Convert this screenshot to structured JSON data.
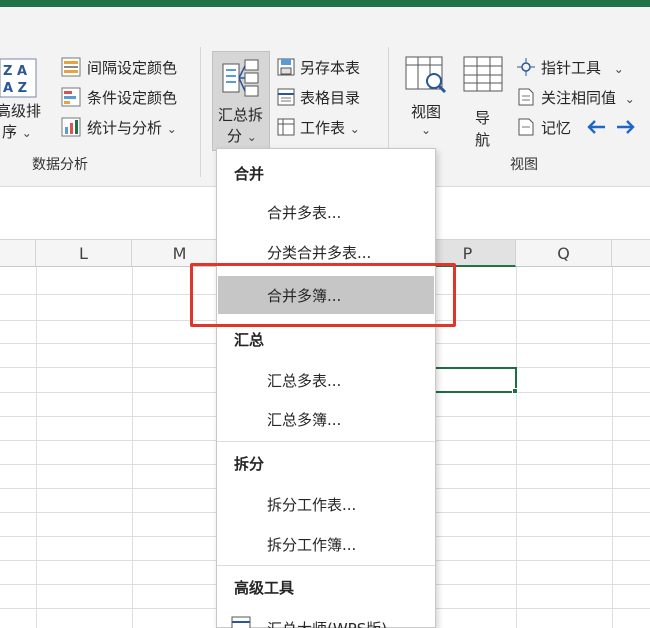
{
  "ribbon": {
    "sort_large": {
      "line1": "高级排",
      "line2": "序"
    },
    "data_group": {
      "interval_color": "间隔设定颜色",
      "condition_color": "条件设定颜色",
      "stats_analysis": "统计与分析",
      "group_label": "数据分析"
    },
    "summary_split": {
      "line1": "汇总拆",
      "line2": "分"
    },
    "sheet_group": {
      "save_as": "另存本表",
      "toc": "表格目录",
      "worksheet": "工作表"
    },
    "view_group": {
      "view": "视图",
      "nav_line1": "导",
      "nav_line2": "航",
      "pointer_tool": "指针工具",
      "focus_same": "关注相同值",
      "memo": "记忆",
      "group_label": "视图"
    }
  },
  "grid": {
    "columns": [
      "L",
      "M",
      "P",
      "Q"
    ]
  },
  "menu": {
    "merge_header": "合并",
    "merge_sheets": "合并多表...",
    "classify_merge": "分类合并多表...",
    "merge_books": "合并多簿...",
    "summary_header": "汇总",
    "summary_sheets": "汇总多表...",
    "summary_books": "汇总多簿...",
    "split_header": "拆分",
    "split_sheet": "拆分工作表...",
    "split_book": "拆分工作簿...",
    "advanced_header": "高级工具",
    "master_item": "汇总大师(WPS版)"
  },
  "colors": {
    "accent": "#217346",
    "highlight": "#c6c6c6",
    "annotation": "#e0352b"
  }
}
